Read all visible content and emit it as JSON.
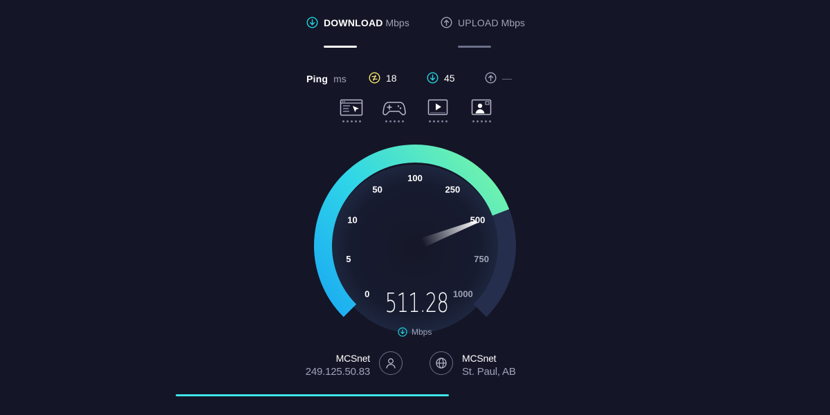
{
  "tabs": {
    "download": {
      "label": "DOWNLOAD",
      "unit": "Mbps",
      "icon": "download-arrow-icon",
      "active": true
    },
    "upload": {
      "label": "UPLOAD",
      "unit": "Mbps",
      "icon": "upload-arrow-icon",
      "active": false
    }
  },
  "ping": {
    "label": "Ping",
    "unit": "ms",
    "idle": {
      "icon": "latency-idle-icon",
      "value": "18"
    },
    "download": {
      "icon": "download-arrow-icon",
      "value": "45"
    },
    "upload": {
      "icon": "upload-arrow-icon",
      "value": "—"
    }
  },
  "activities": [
    {
      "icon": "web-browsing-icon"
    },
    {
      "icon": "gaming-controller-icon"
    },
    {
      "icon": "video-streaming-icon"
    },
    {
      "icon": "video-chat-icon"
    }
  ],
  "gauge": {
    "ticks": [
      "0",
      "5",
      "10",
      "50",
      "100",
      "250",
      "500",
      "750",
      "1000"
    ],
    "current_value": 511.28,
    "fill_fraction": 0.755
  },
  "speed": {
    "value": "511.28",
    "unit": "Mbps"
  },
  "isp": {
    "name": "MCSnet",
    "ip": "249.125.50.83",
    "icon": "user-icon"
  },
  "server": {
    "name": "MCSnet",
    "location": "St. Paul, AB",
    "icon": "globe-icon"
  },
  "progress": {
    "fraction": 0.5
  },
  "colors": {
    "background": "#141526",
    "accent_cyan": "#1fd4e0",
    "accent_green": "#6ff5a6",
    "accent_blue": "#1aa7f2",
    "ping_yellow": "#f2e46b",
    "muted": "#9ea3b8",
    "track": "#252e4d"
  }
}
